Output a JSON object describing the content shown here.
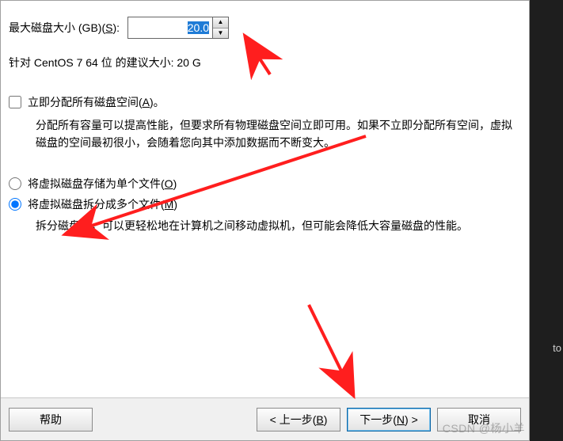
{
  "size": {
    "label_pre": "最大磁盘大小 (GB)(",
    "label_acc": "S",
    "label_post": "):",
    "value": "20.0"
  },
  "hint": {
    "text_pre": "针对 CentOS 7 64 位 的建议大小: 20 G",
    "text_post": ""
  },
  "alloc": {
    "label_pre": "立即分配所有磁盘空间(",
    "label_acc": "A",
    "label_post": ")。",
    "desc": "分配所有容量可以提高性能，但要求所有物理磁盘空间立即可用。如果不立即分配所有空间，虚拟磁盘的空间最初很小，会随着您向其中添加数据而不断变大。"
  },
  "store": {
    "single_pre": "将虚拟磁盘存储为单个文件(",
    "single_acc": "O",
    "single_post": ")",
    "split_pre": "将虚拟磁盘拆分成多个文件(",
    "split_acc": "M",
    "split_post": ")",
    "split_desc": "拆分磁盘后，可以更轻松地在计算机之间移动虚拟机，但可能会降低大容量磁盘的性能。"
  },
  "buttons": {
    "help": "帮助",
    "back_pre": "< 上一步(",
    "back_acc": "B",
    "back_post": ")",
    "next_pre": "下一步(",
    "next_acc": "N",
    "next_post": ") >",
    "cancel": "取消"
  },
  "sidebar": {
    "marker": "to"
  },
  "watermark": "CSDN @杨小羊"
}
